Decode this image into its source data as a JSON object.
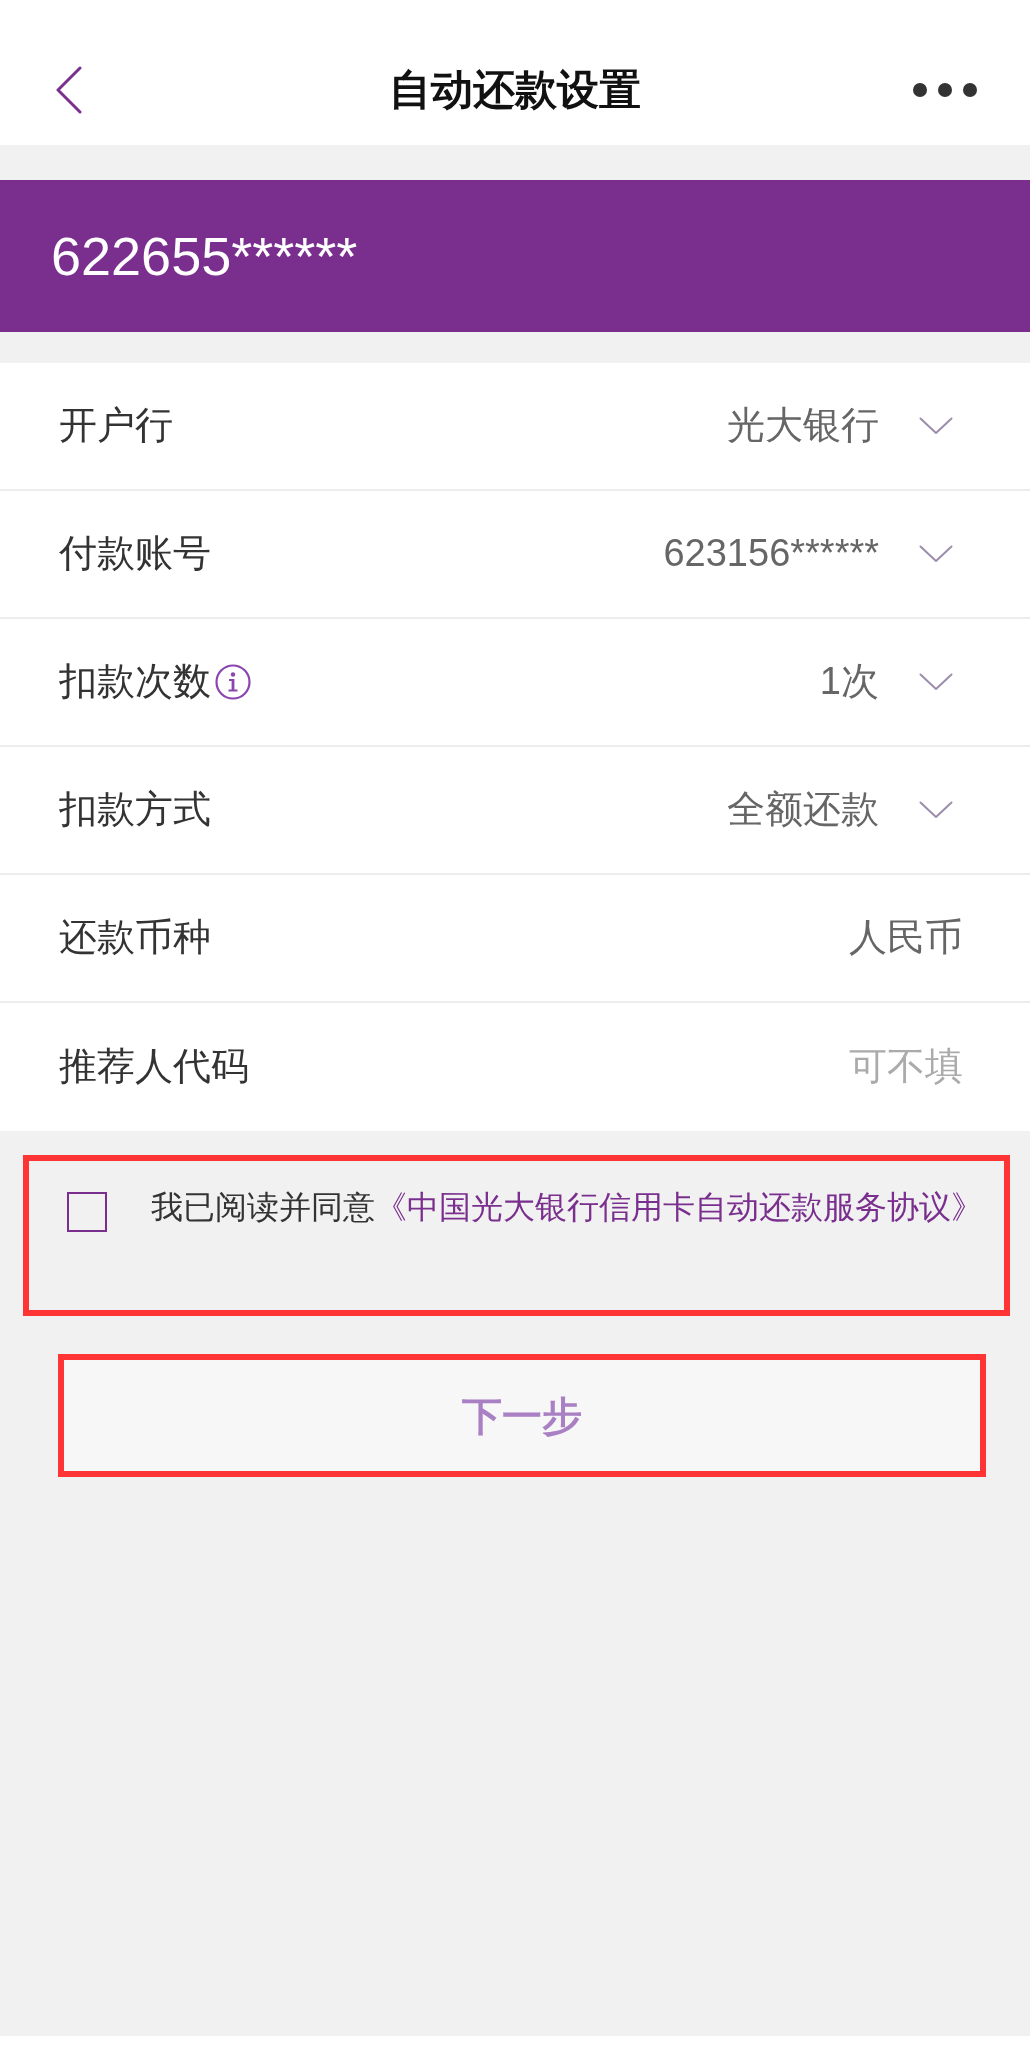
{
  "header": {
    "title": "自动还款设置"
  },
  "card": {
    "number": "622655******"
  },
  "fields": [
    {
      "kind": "select",
      "label": "开户行",
      "value": "光大银行",
      "info": false
    },
    {
      "kind": "select",
      "label": "付款账号",
      "value": "623156******",
      "info": false
    },
    {
      "kind": "select",
      "label": "扣款次数",
      "value": "1次",
      "info": true
    },
    {
      "kind": "select",
      "label": "扣款方式",
      "value": "全额还款",
      "info": false
    },
    {
      "kind": "text",
      "label": "还款币种",
      "value": "人民币",
      "info": false
    },
    {
      "kind": "input",
      "label": "推荐人代码",
      "placeholder": "可不填",
      "info": false
    }
  ],
  "agreement": {
    "checked": false,
    "highlighted": true,
    "text": "我已阅读并同意",
    "link": "《中国光大银行信用卡自动还款服务协议》"
  },
  "next_button": {
    "label": "下一步",
    "disabled": true,
    "highlighted": true
  }
}
